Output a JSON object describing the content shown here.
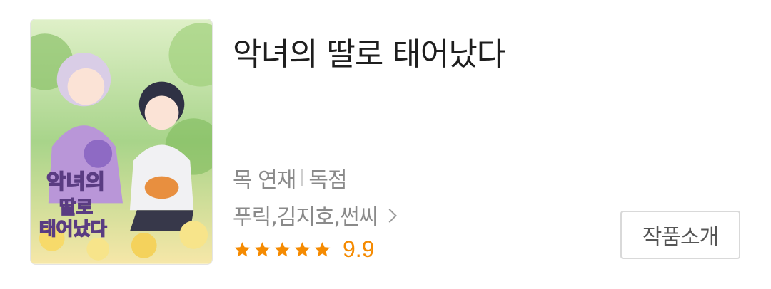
{
  "work": {
    "title": "악녀의 딸로 태어났다",
    "cover_title": "악녀의 딸로 태어났다"
  },
  "meta": {
    "schedule": "목 연재",
    "exclusive": "독점"
  },
  "authors": {
    "text": "푸릭,김지호,썬씨"
  },
  "rating": {
    "stars": 5,
    "score": "9.9",
    "star_color": "#f58a00"
  },
  "intro_button": {
    "label": "작품소개"
  }
}
